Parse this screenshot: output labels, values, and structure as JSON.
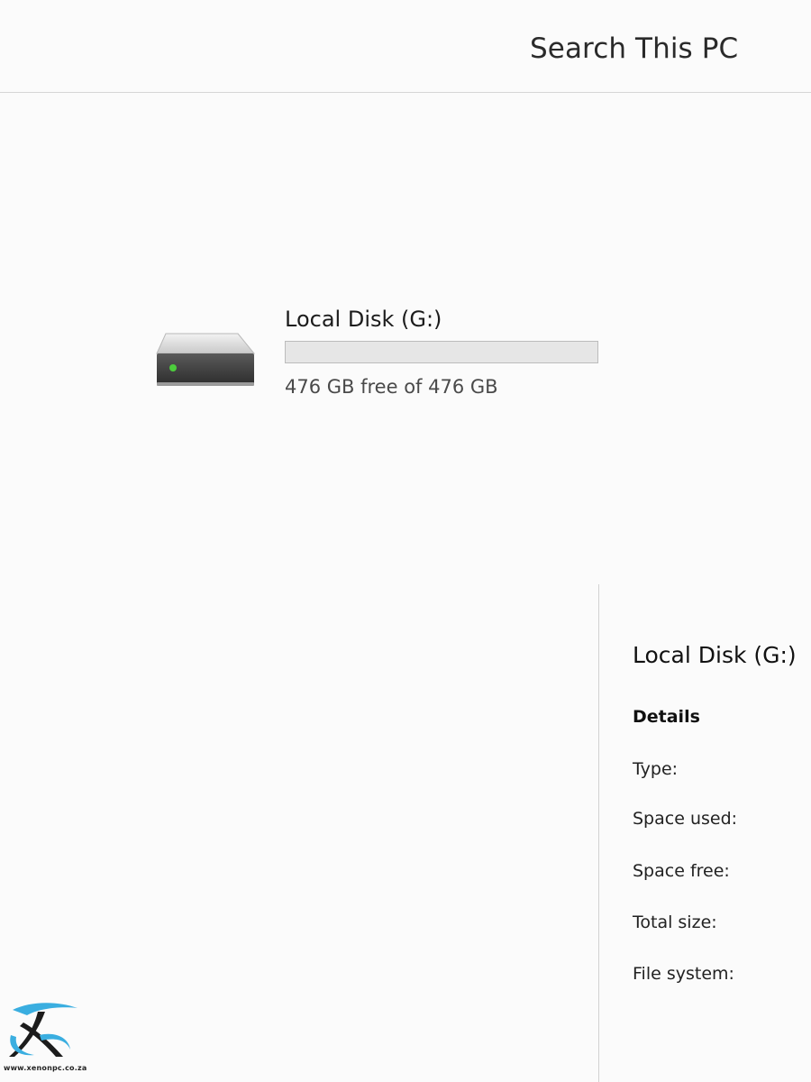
{
  "search": {
    "placeholder": "Search This PC"
  },
  "drive": {
    "name": "Local Disk (G:)",
    "free_text": "476 GB free of 476 GB",
    "used_fraction": 0,
    "icon": "hard-drive-icon",
    "status_color": "#4ccd3c"
  },
  "details": {
    "title": "Local Disk (G:)",
    "heading": "Details",
    "labels": [
      "Type:",
      "Space used:",
      "Space free:",
      "Total size:",
      "File system:"
    ]
  },
  "watermark": {
    "url": "www.xenonpc.co.za",
    "logo": "xenonpc-logo"
  },
  "colors": {
    "background": "#fbfbfb",
    "divider": "#d6d6d6",
    "bar_background": "#e6e6e6",
    "bar_fill": "#26a0da"
  }
}
